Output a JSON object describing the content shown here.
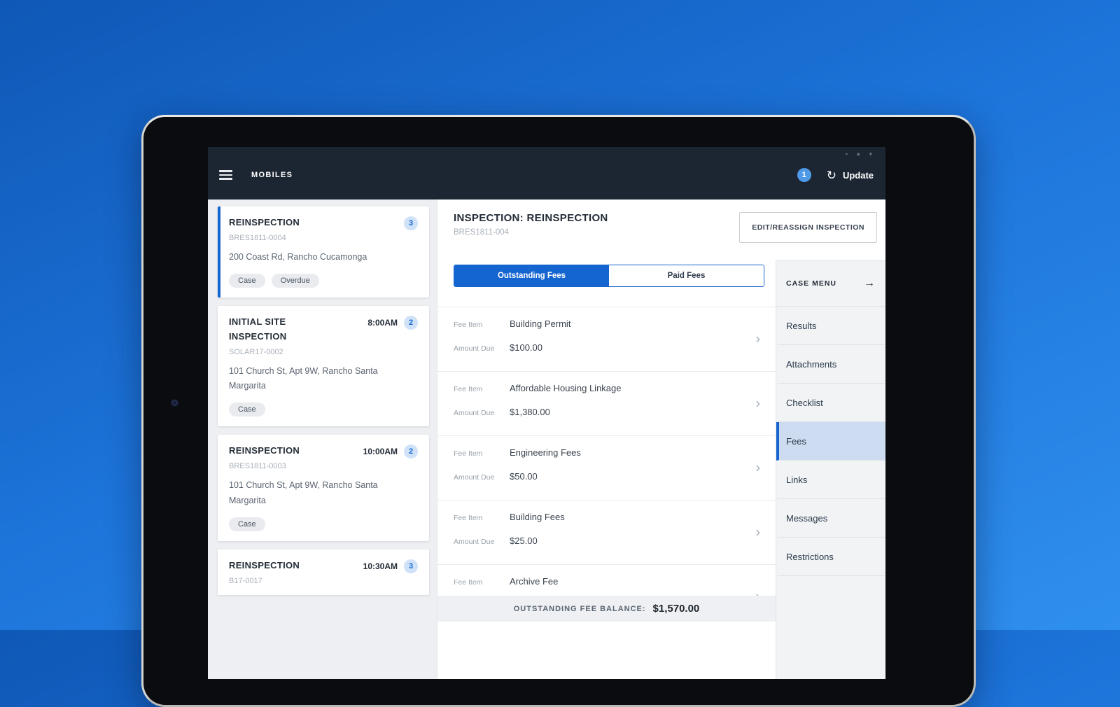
{
  "colors": {
    "accent_blue": "#1565d1",
    "appbar_navy": "#1c2632",
    "badge_light_bg": "#cfe2f8",
    "panel_gray": "#edeff2",
    "sidebar_gray": "#f1f3f5",
    "active_menu_bg": "#cddcf0",
    "page_gradient_top": "#0f58b6",
    "page_gradient_bottom": "#2f8fee"
  },
  "icons": {
    "status_glyphs": "▪ ● ▾",
    "refresh": "↻",
    "chevron_right": "›",
    "arrow_right": "→"
  },
  "appbar": {
    "title": "MOBILES",
    "notification_count": "1",
    "update_label": "Update"
  },
  "inspection_list": {
    "cards": [
      {
        "title": "REINSPECTION",
        "time": "",
        "badge": "3",
        "id": "BRES1811-0004",
        "address": "200 Coast Rd, Rancho Cucamonga",
        "tags": [
          "Case",
          "Overdue"
        ],
        "active": true
      },
      {
        "title": "INITIAL SITE INSPECTION",
        "time": "8:00AM",
        "badge": "2",
        "id": "SOLAR17-0002",
        "address": "101 Church St, Apt 9W, Rancho Santa Margarita",
        "tags": [
          "Case"
        ],
        "active": false
      },
      {
        "title": "REINSPECTION",
        "time": "10:00AM",
        "badge": "2",
        "id": "BRES1811-0003",
        "address": "101 Church St, Apt 9W, Rancho Santa Margarita",
        "tags": [
          "Case"
        ],
        "active": false
      },
      {
        "title": "REINSPECTION",
        "time": "10:30AM",
        "badge": "3",
        "id": "B17-0017",
        "address": "",
        "tags": [],
        "active": false
      }
    ]
  },
  "detail": {
    "title": "INSPECTION: REINSPECTION",
    "record_id": "BRES1811-004",
    "edit_button_label": "EDIT/REASSIGN INSPECTION",
    "tabs": [
      {
        "label": "Outstanding Fees",
        "active": true
      },
      {
        "label": "Paid Fees",
        "active": false
      }
    ],
    "fee_item_label": "Fee Item",
    "amount_due_label": "Amount Due",
    "fees": [
      {
        "name": "Building Permit",
        "amount": "$100.00"
      },
      {
        "name": "Affordable Housing Linkage",
        "amount": "$1,380.00"
      },
      {
        "name": "Engineering Fees",
        "amount": "$50.00"
      },
      {
        "name": "Building Fees",
        "amount": "$25.00"
      },
      {
        "name": "Archive Fee",
        "amount": ""
      }
    ],
    "balance_label": "OUTSTANDING FEE BALANCE:",
    "balance_value": "$1,570.00"
  },
  "case_menu": {
    "title": "CASE MENU",
    "items": [
      {
        "label": "Results",
        "active": false
      },
      {
        "label": "Attachments",
        "active": false
      },
      {
        "label": "Checklist",
        "active": false
      },
      {
        "label": "Fees",
        "active": true
      },
      {
        "label": "Links",
        "active": false
      },
      {
        "label": "Messages",
        "active": false
      },
      {
        "label": "Restrictions",
        "active": false
      }
    ]
  }
}
